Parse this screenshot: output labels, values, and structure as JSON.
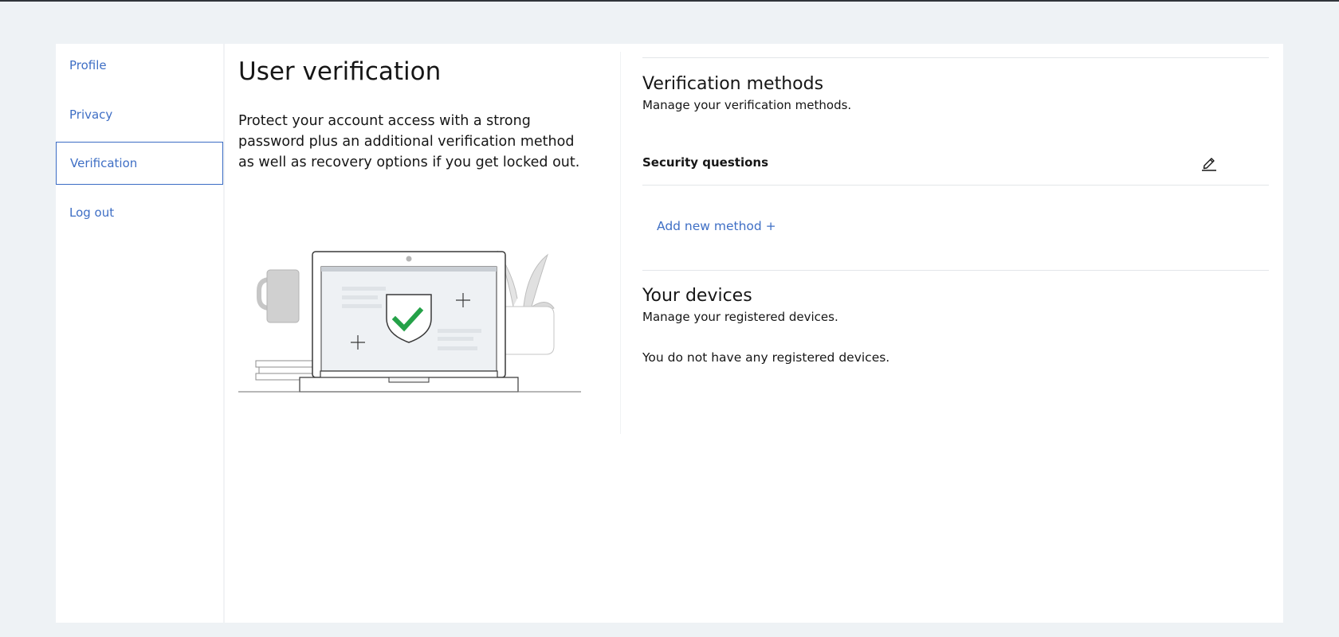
{
  "sidebar": {
    "items": [
      {
        "label": "Profile",
        "active": false
      },
      {
        "label": "Privacy",
        "active": false
      },
      {
        "label": "Verification",
        "active": true
      },
      {
        "label": "Log out",
        "active": false
      }
    ]
  },
  "main": {
    "title": "User verification",
    "description": "Protect your account access with a strong password plus an additional verification method as well as recovery options if you get locked out."
  },
  "verification_methods": {
    "title": "Verification methods",
    "subtitle": "Manage your verification methods.",
    "methods": [
      {
        "label": "Security questions",
        "action_icon": "pencil-edit-icon"
      }
    ],
    "add_label": "Add new method +"
  },
  "devices": {
    "title": "Your devices",
    "subtitle": "Manage your registered devices.",
    "empty_message": "You do not have any registered devices."
  },
  "colors": {
    "link": "#3f6fc5",
    "page_background": "#eef2f5",
    "card_background": "#ffffff",
    "check_green": "#24a148"
  }
}
